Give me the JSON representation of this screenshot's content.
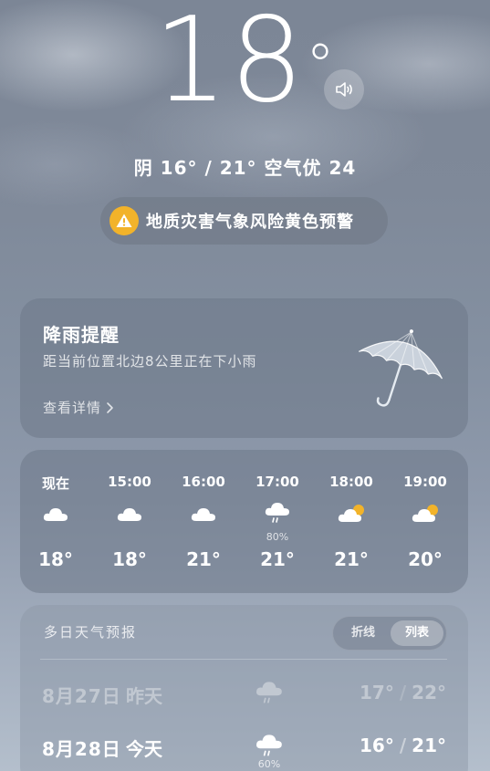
{
  "current": {
    "temp": "18",
    "deg": "°",
    "summary": "阴 16° / 21° 空气优 24",
    "speaker_icon": "speaker-icon"
  },
  "alert": {
    "icon": "warning-icon",
    "text": "地质灾害气象风险黄色预警",
    "color": "#f2b32a"
  },
  "rain_card": {
    "title": "降雨提醒",
    "description": "距当前位置北边8公里正在下小雨",
    "link": "查看详情",
    "icon": "umbrella-icon"
  },
  "hourly": [
    {
      "time": "现在",
      "icon": "cloudy-icon",
      "pop": "",
      "temp": "18°"
    },
    {
      "time": "15:00",
      "icon": "cloudy-icon",
      "pop": "",
      "temp": "18°"
    },
    {
      "time": "16:00",
      "icon": "cloudy-icon",
      "pop": "",
      "temp": "21°"
    },
    {
      "time": "17:00",
      "icon": "rain-icon",
      "pop": "80%",
      "temp": "21°"
    },
    {
      "time": "18:00",
      "icon": "partly-cloudy-icon",
      "pop": "",
      "temp": "21°"
    },
    {
      "time": "19:00",
      "icon": "partly-cloudy-icon",
      "pop": "",
      "temp": "20°"
    }
  ],
  "daily": {
    "title": "多日天气预报",
    "toggle": {
      "line": "折线",
      "list": "列表",
      "selected": "列表"
    },
    "days": [
      {
        "date": "8月27日",
        "label": "昨天",
        "icon": "rain-icon",
        "pop": "",
        "low": "17°",
        "sep": "/",
        "high": "22°"
      },
      {
        "date": "8月28日",
        "label": "今天",
        "icon": "rain-icon",
        "pop": "60%",
        "low": "16°",
        "sep": "/",
        "high": "21°"
      }
    ]
  }
}
